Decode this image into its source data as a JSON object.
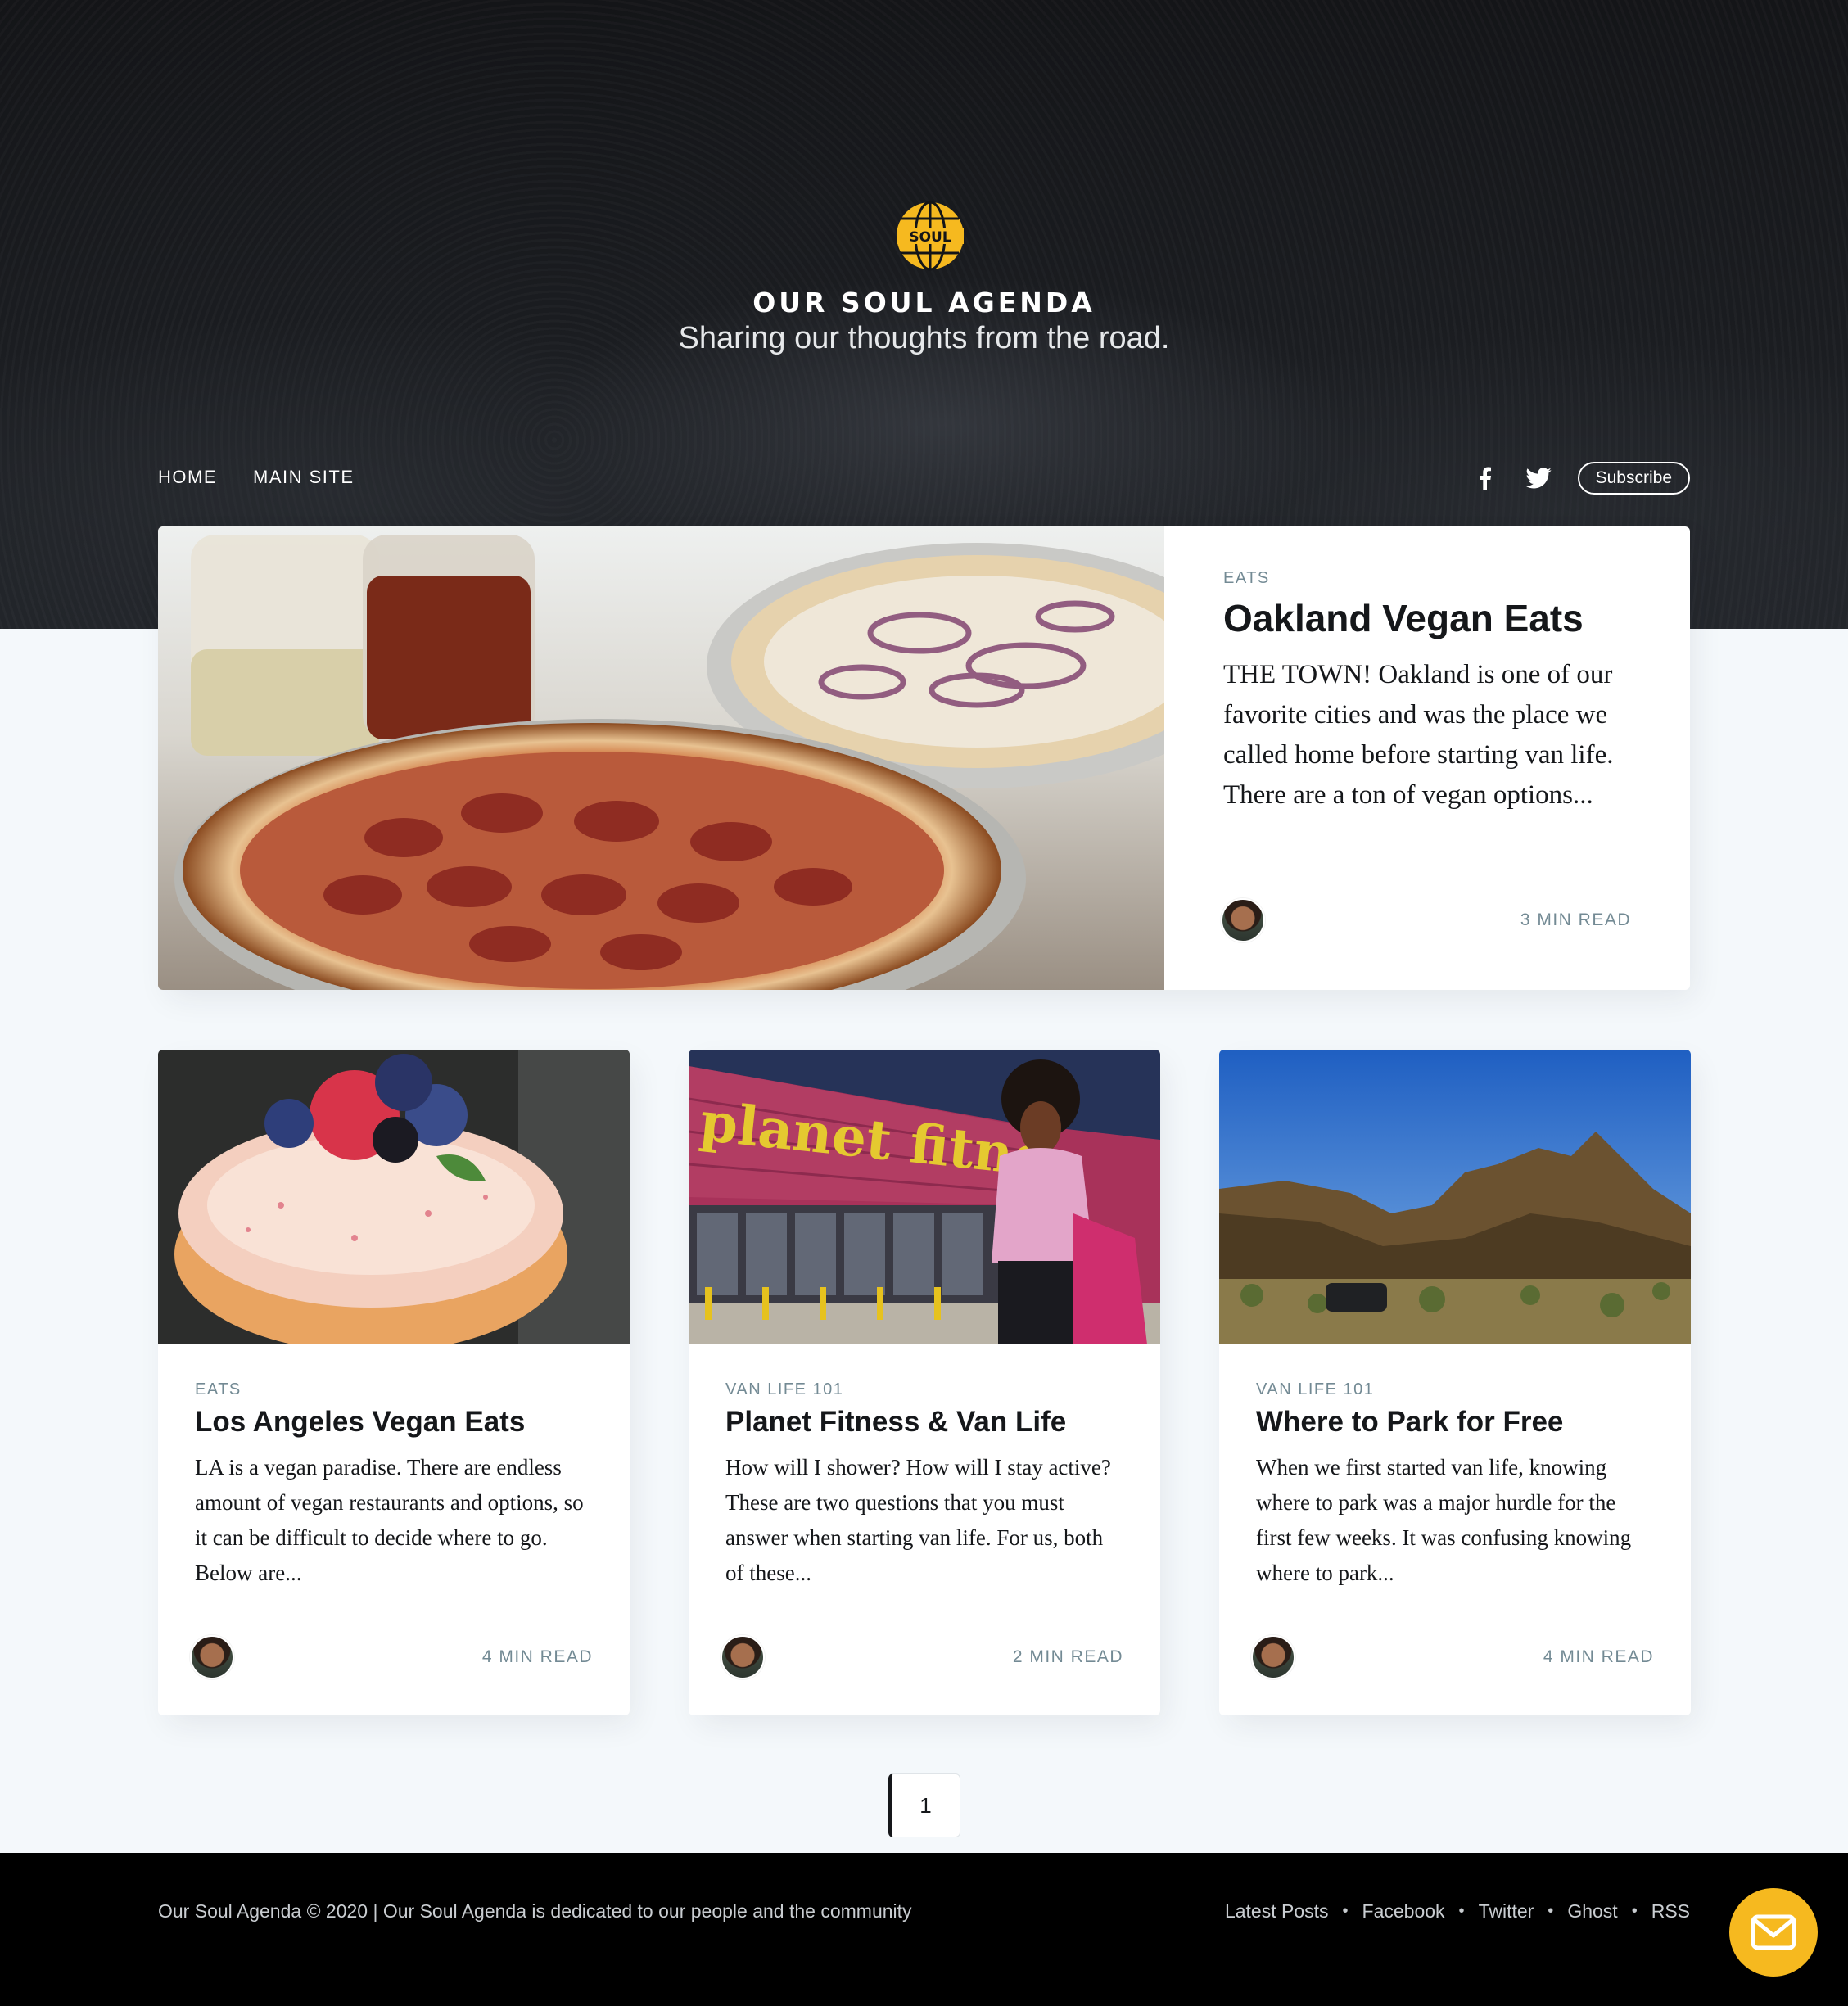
{
  "site": {
    "title": "OUR SOUL AGENDA",
    "description": "Sharing our thoughts from the road.",
    "logo_text": "SOUL"
  },
  "nav": {
    "items": [
      "HOME",
      "MAIN SITE"
    ],
    "subscribe_label": "Subscribe",
    "social_icons": [
      "facebook-icon",
      "twitter-icon"
    ]
  },
  "feature": {
    "tag": "EATS",
    "title": "Oakland Vegan Eats",
    "excerpt": "THE TOWN! Oakland is one of our favorite cities and was the place we called home before starting van life. There are a ton of vegan options...",
    "read_time": "3 MIN READ"
  },
  "posts": [
    {
      "tag": "EATS",
      "title": "Los Angeles Vegan Eats",
      "excerpt": "LA is a vegan paradise. There are endless amount of vegan restaurants and options, so it can be difficult to decide where to go. Below are...",
      "read_time": "4 MIN READ"
    },
    {
      "tag": "VAN LIFE 101",
      "title": "Planet Fitness & Van Life",
      "excerpt": "How will I shower? How will I stay active? These are two questions that you must answer when starting van life. For us, both of these...",
      "read_time": "2 MIN READ",
      "image_sign": "planet fitne"
    },
    {
      "tag": "VAN LIFE 101",
      "title": "Where to Park for Free",
      "excerpt": "When we first started van life, knowing where to park was a major hurdle for the first few weeks. It was confusing knowing where to park...",
      "read_time": "4 MIN READ"
    }
  ],
  "pagination": {
    "current": "1"
  },
  "footer": {
    "copyright": "Our Soul Agenda © 2020 | Our Soul Agenda is dedicated to our people and the community",
    "links": [
      "Latest Posts",
      "Facebook",
      "Twitter",
      "Ghost",
      "RSS"
    ]
  },
  "colors": {
    "accent": "#f6b91f",
    "text": "#15171a",
    "meta": "#738a94",
    "background": "#f4f8fb"
  }
}
